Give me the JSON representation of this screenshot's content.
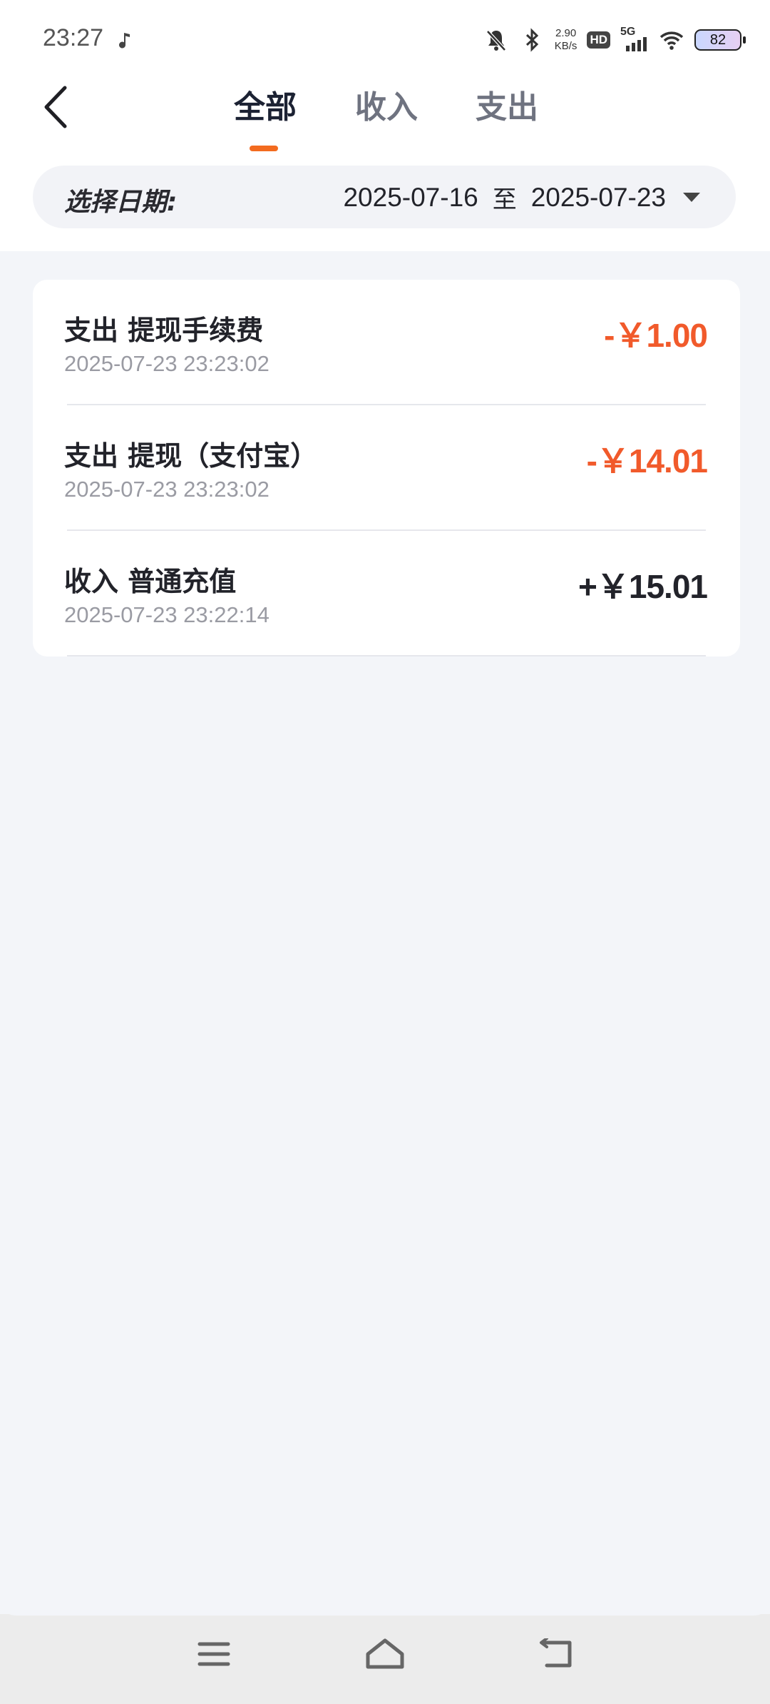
{
  "status_bar": {
    "time": "23:27",
    "speed_value": "2.90",
    "speed_unit": "KB/s",
    "hd_label": "HD",
    "network_label": "5G",
    "battery": "82",
    "icons": [
      "music-note-icon",
      "mute-bell-icon",
      "bluetooth-icon",
      "signal-icon",
      "wifi-icon",
      "battery-icon"
    ]
  },
  "header": {
    "tabs": [
      {
        "label": "全部",
        "active": true
      },
      {
        "label": "收入",
        "active": false
      },
      {
        "label": "支出",
        "active": false
      }
    ],
    "accent_color": "#f36b1f"
  },
  "date_filter": {
    "label": "选择日期:",
    "start": "2025-07-16",
    "separator": "至",
    "end": "2025-07-23"
  },
  "transactions": [
    {
      "title": "支出 提现手续费",
      "time": "2025-07-23 23:23:02",
      "amount": "-￥1.00",
      "type": "expense"
    },
    {
      "title": "支出 提现（支付宝）",
      "time": "2025-07-23 23:23:02",
      "amount": "-￥14.01",
      "type": "expense"
    },
    {
      "title": "收入 普通充值",
      "time": "2025-07-23 23:22:14",
      "amount": "+￥15.01",
      "type": "income"
    }
  ],
  "colors": {
    "expense": "#f15a2b",
    "income": "#22232a",
    "background": "#f3f5f9"
  }
}
